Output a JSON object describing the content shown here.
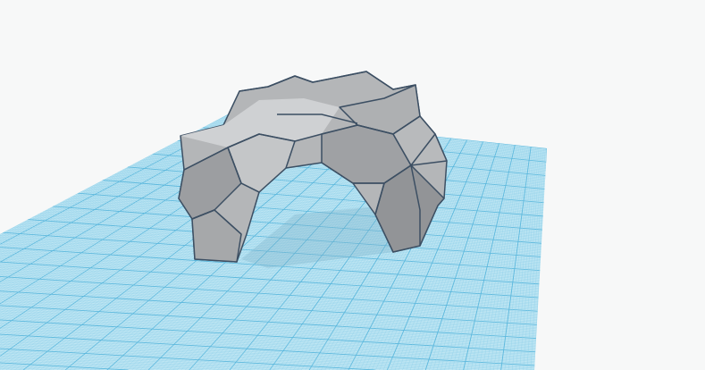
{
  "viewport": {
    "background_color": "#f7f8f8",
    "workplane_color": "#bfe6f3",
    "grid_minor_color": "#8fd0ea",
    "grid_major_color": "#5cb8dd",
    "shape_fill_color": "#b4b6b8",
    "shape_edge_color": "#3c4f63",
    "grid_divisions": 40
  }
}
